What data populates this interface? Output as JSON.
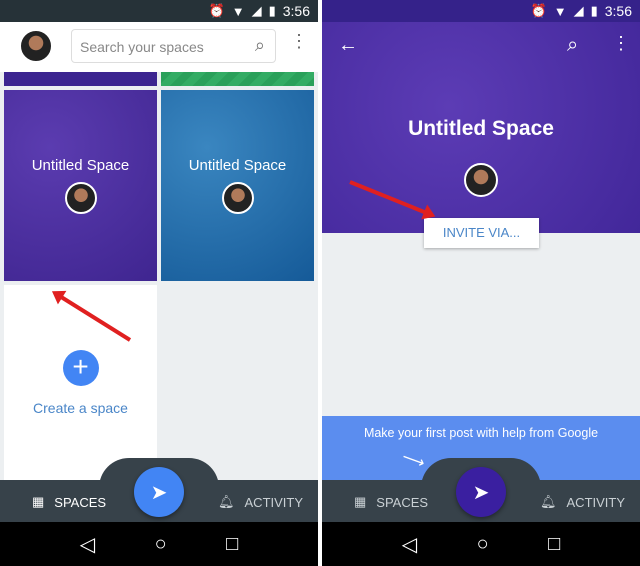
{
  "status": {
    "time": "3:56",
    "icons": [
      "alarm-icon",
      "wifi-icon",
      "signal-icon",
      "signal-roaming-icon",
      "battery-charging-icon"
    ]
  },
  "left": {
    "search": {
      "placeholder": "Search your spaces"
    },
    "tiles": [
      {
        "title": "Untitled Space",
        "color": "#4b2fa0"
      },
      {
        "title": "Untitled Space",
        "color": "#1c6aa8"
      }
    ],
    "create": {
      "label": "Create a space",
      "icon": "plus-icon"
    },
    "nav": {
      "spaces": "SPACES",
      "activity": "ACTIVITY"
    },
    "fab_color": "#4285f4"
  },
  "right": {
    "title": "Untitled Space",
    "invite": "INVITE VIA...",
    "hint": "Make your first post with help from Google",
    "nav": {
      "spaces": "SPACES",
      "activity": "ACTIVITY"
    },
    "fab_color": "#3a1fa0"
  }
}
